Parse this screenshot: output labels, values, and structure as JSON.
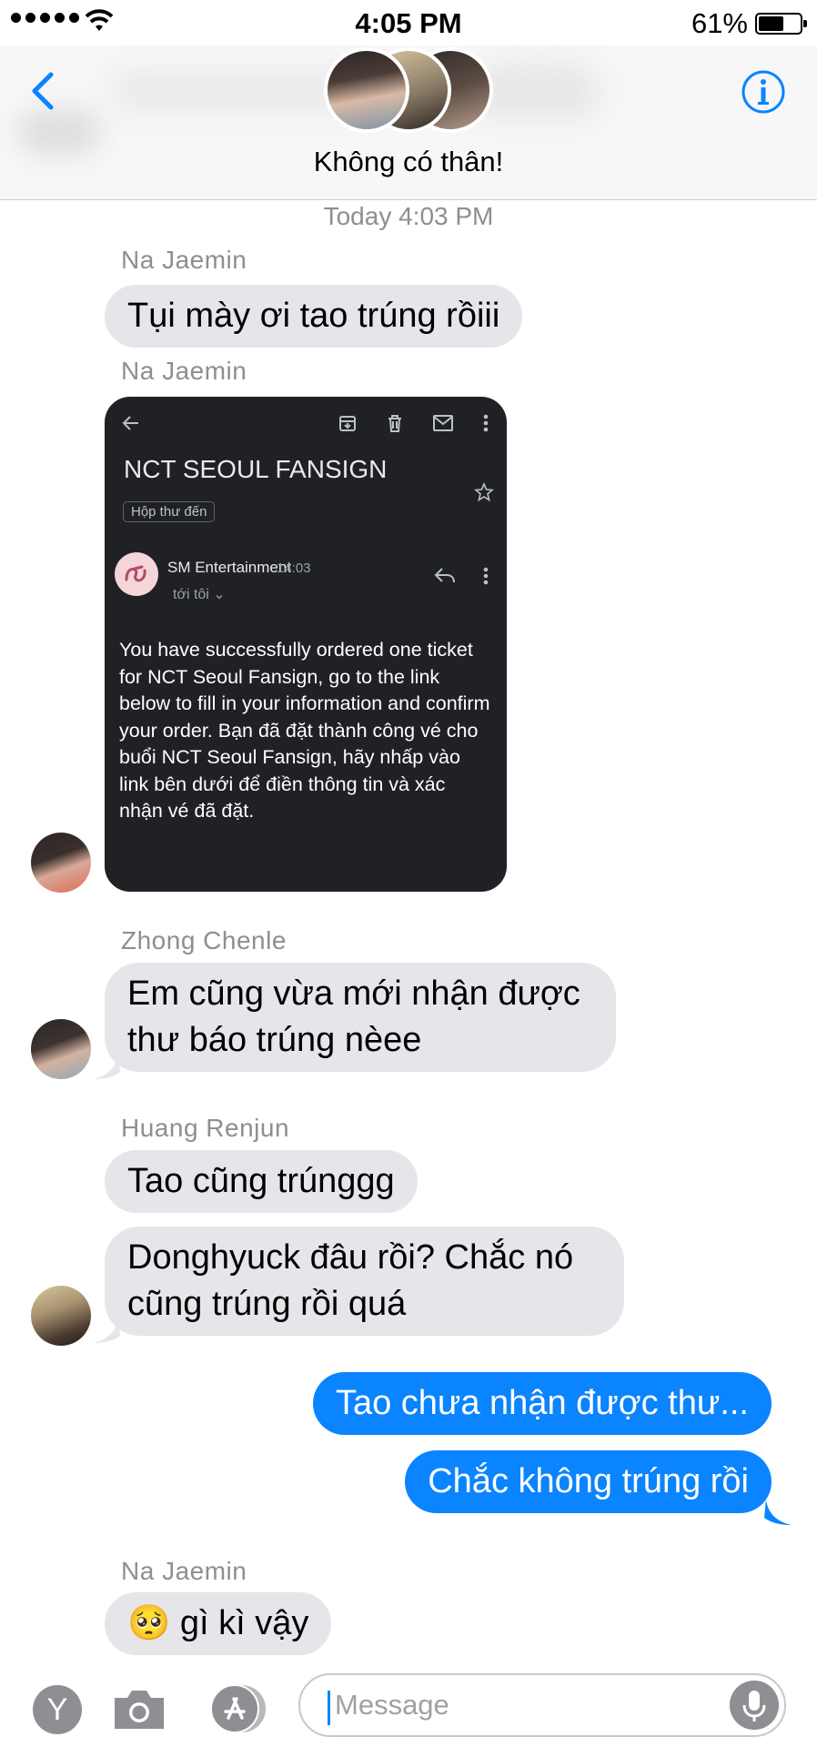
{
  "status_bar": {
    "time": "4:05 PM",
    "battery": "61%",
    "battery_level": 0.61
  },
  "header": {
    "group_name": "Không có thân!"
  },
  "chat": {
    "timestamp": "Today 4:03 PM",
    "messages": [
      {
        "sender": "Na Jaemin",
        "text": "Tụi mày ơi tao trúng rồiii"
      },
      {
        "sender": "Na Jaemin"
      },
      {
        "sender": "Zhong Chenle",
        "text": "Em cũng vừa mới nhận được thư báo trúng nèee"
      },
      {
        "sender": "Huang Renjun",
        "text": "Tao cũng trúnggg"
      },
      {
        "text": "Donghyuck đâu rồi? Chắc nó cũng trúng rồi quá"
      },
      {
        "text": "Tao chưa nhận được thư..."
      },
      {
        "text": "Chắc không trúng rồi"
      },
      {
        "sender": "Na Jaemin",
        "emoji": "🥺",
        "text": "gì kì vậy"
      }
    ]
  },
  "email_screenshot": {
    "subject": "NCT SEOUL FANSIGN",
    "label": "Hộp thư đến",
    "sender": "SM Entertainment",
    "time": "14:03",
    "to": "tới tôi",
    "body": "You have successfully ordered one ticket for NCT Seoul Fansign, go to the link below to fill in your information and confirm your order. Bạn đã đặt thành công vé cho buổi NCT Seoul Fansign, hãy nhấp vào link bên dưới để điền thông tin và xác nhận vé đã đặt."
  },
  "input_bar": {
    "app_letter": "Y",
    "placeholder": "Message"
  },
  "colors": {
    "accent": "#0b84ff",
    "incoming_bubble": "#e5e5ea",
    "meta_text": "#8e8e93"
  },
  "icons": [
    "back-chevron-icon",
    "info-icon",
    "archive-icon",
    "trash-icon",
    "mail-icon",
    "more-vert-icon",
    "star-icon",
    "reply-icon",
    "camera-icon",
    "app-store-icon",
    "microphone-icon"
  ]
}
